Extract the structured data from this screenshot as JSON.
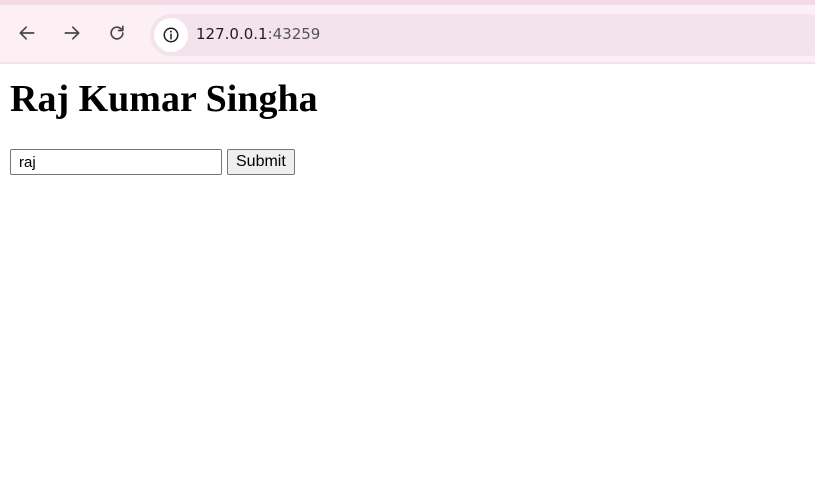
{
  "browser": {
    "url_host": "127.0.0.1",
    "url_port": ":43259",
    "icons": {
      "back": "arrow-left-icon",
      "forward": "arrow-right-icon",
      "reload": "reload-icon",
      "site_info": "info-icon"
    }
  },
  "page": {
    "heading": "Raj Kumar Singha",
    "form": {
      "input_value": "raj",
      "submit_label": "Submit"
    }
  }
}
